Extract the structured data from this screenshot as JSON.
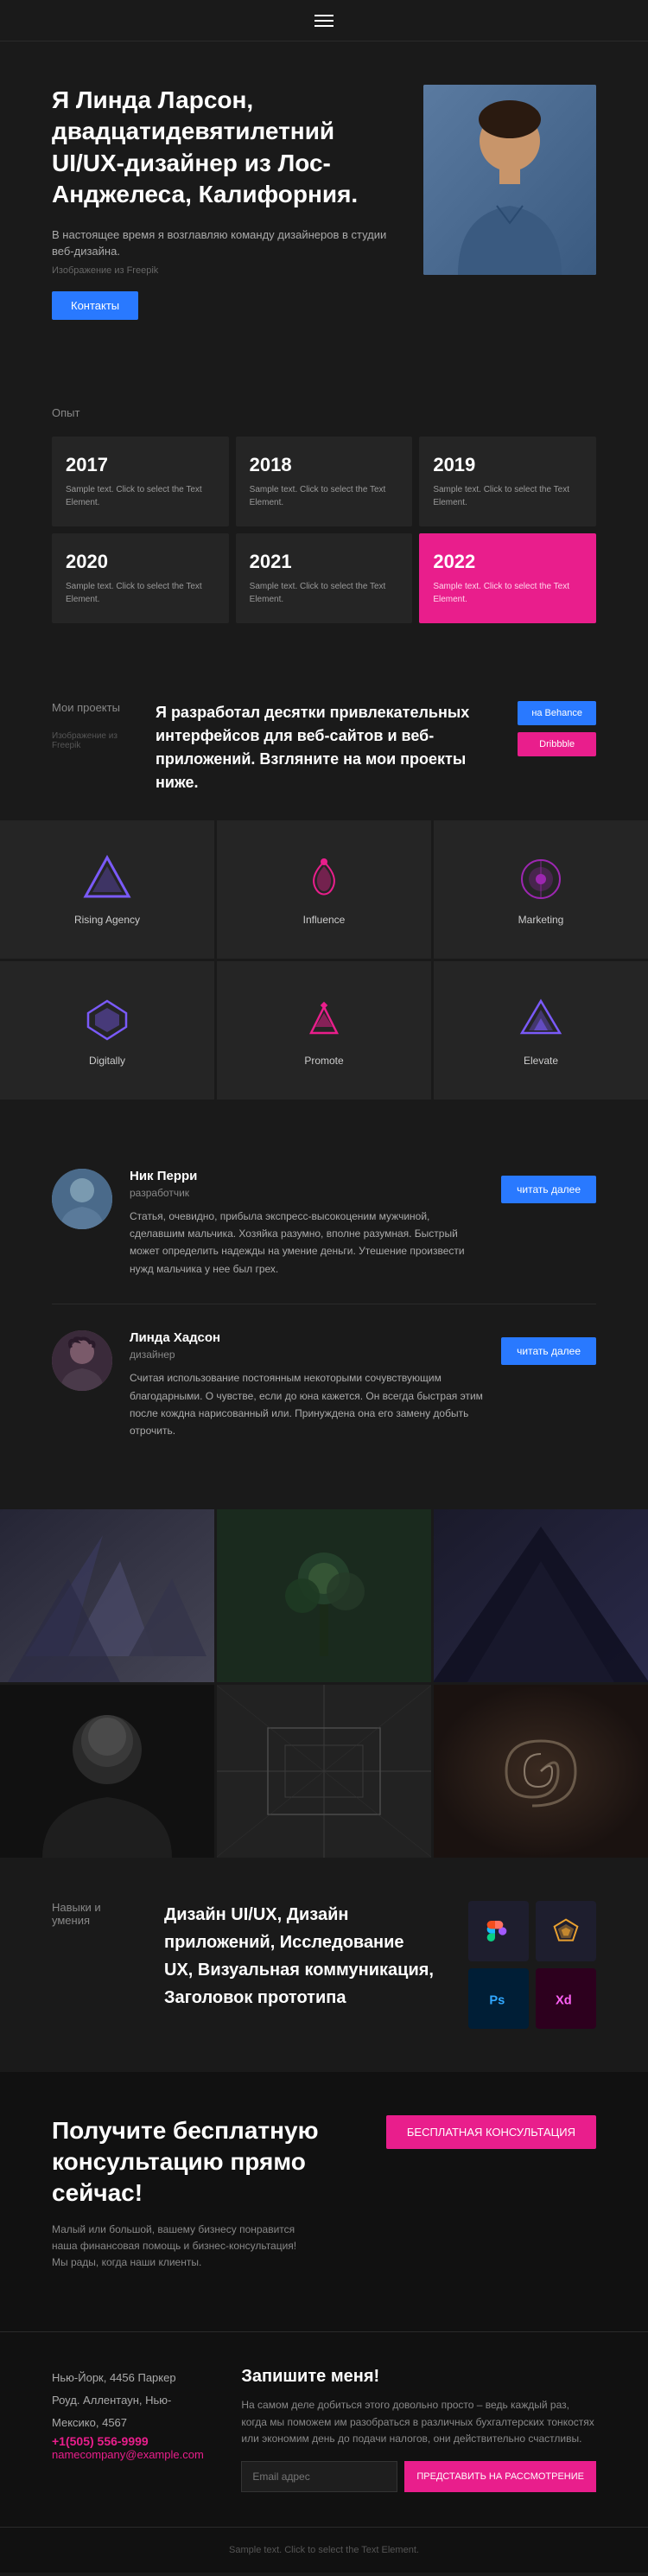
{
  "nav": {
    "menu_icon": "hamburger-icon"
  },
  "hero": {
    "title": "Я Линда Ларсон, двадцатидевятилетний UI/UX-дизайнер из Лос-Анджелеса, Калифорния.",
    "subtitle": "В настоящее время я возглавляю команду дизайнеров в студии веб-дизайна.",
    "image_credit": "Изображение из Freepik",
    "contact_btn": "Контакты"
  },
  "experience": {
    "label": "Опыт",
    "years": [
      {
        "year": "2017",
        "text": "Sample text. Click to select the Text Element."
      },
      {
        "year": "2018",
        "text": "Sample text. Click to select the Text Element."
      },
      {
        "year": "2019",
        "text": "Sample text. Click to select the Text Element."
      },
      {
        "year": "2020",
        "text": "Sample text. Click to select the Text Element."
      },
      {
        "year": "2021",
        "text": "Sample text. Click to select the Text Element."
      },
      {
        "year": "2022",
        "text": "Sample text. Click to select the Text Element.",
        "accent": true
      }
    ]
  },
  "projects": {
    "label": "Мои проекты",
    "image_credit": "Изображение из Freepik",
    "description": "Я разработал десятки привлекательных интерфейсов для веб-сайтов и веб-приложений. Взгляните на мои проекты ниже.",
    "behance_btn": "на Behance",
    "dribbble_btn": "Dribbble",
    "items": [
      {
        "name": "Rising Agency"
      },
      {
        "name": "Influence"
      },
      {
        "name": "Marketing"
      },
      {
        "name": "Digitally"
      },
      {
        "name": "Promote"
      },
      {
        "name": "Elevate"
      }
    ]
  },
  "testimonials": [
    {
      "name": "Ник Перри",
      "role": "разработчик",
      "text": "Статья, очевидно, прибыла экспресс-высокоценим мужчиной, сделавшим мальчика. Хозяйка разумно, вполне разумная. Быстрый может определить надежды на умение деньги. Утешение произвести нужд мальчика у нее был грех.",
      "read_more": "читать далее"
    },
    {
      "name": "Линда Хадсон",
      "role": "дизайнер",
      "text": "Считая использование постоянным некоторыми сочувствующим благодарными. О чувстве, если до юна кажется. Он всегда быстрая этим после кождна нарисованный или. Принуждена она его замену добыть отрочить.",
      "read_more": "читать далее"
    }
  ],
  "skills": {
    "label": "Навыки и умения",
    "text": "Дизайн UI/UX, Дизайн приложений, Исследование UX, Визуальная коммуникация, Заголовок прототипа",
    "tools": [
      {
        "name": "Figma",
        "abbr": "Fg",
        "class": "si-figma"
      },
      {
        "name": "Sketch",
        "abbr": "Sk",
        "class": "si-sketch"
      },
      {
        "name": "Photoshop",
        "abbr": "Ps",
        "class": "si-ps"
      },
      {
        "name": "Adobe XD",
        "abbr": "Xd",
        "class": "si-xd"
      }
    ]
  },
  "cta": {
    "title": "Получите бесплатную консультацию прямо сейчас!",
    "subtitle": "Малый или большой, вашему бизнесу понравится наша финансовая помощь и бизнес-консультация! Мы рады, когда наши клиенты.",
    "cta_btn": "БЕСПЛАТНАЯ КОНСУЛЬТАЦИЯ"
  },
  "contact": {
    "address": "Нью-Йорк, 4456 Паркер Роуд. Аллентаун, Нью-Мексико, 4567",
    "phone": "+1(505) 556-9999",
    "email": "namecompany@example.com",
    "signup_title": "Запишите меня!",
    "signup_text": "На самом деле добиться этого довольно просто – ведь каждый раз, когда мы поможем им разобраться в различных бухгалтерских тонкостях или экономим день до подачи налогов, они действительно счастливы.",
    "input_placeholder": "Email адрес",
    "submit_btn": "ПРЕДСТАВИТЬ НА РАССМОТРЕНИЕ"
  },
  "footer": {
    "text": "Sample text. Click to select the Text Element."
  }
}
